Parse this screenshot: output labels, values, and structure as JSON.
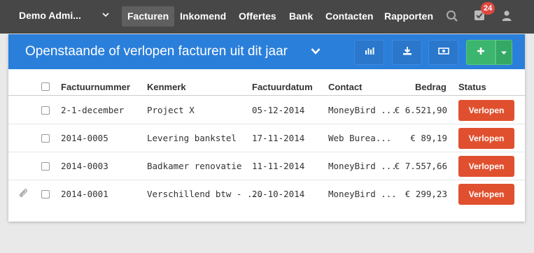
{
  "navbar": {
    "brand": "Demo Admi...",
    "items": [
      "Facturen",
      "Inkomend",
      "Offertes",
      "Bank",
      "Contacten",
      "Rapporten"
    ],
    "active": "Facturen",
    "notification_count": "24"
  },
  "panel": {
    "title": "Openstaande of verlopen facturen uit dit jaar"
  },
  "table": {
    "columns": {
      "factuurnummer": "Factuurnummer",
      "kenmerk": "Kenmerk",
      "factuurdatum": "Factuurdatum",
      "contact": "Contact",
      "bedrag": "Bedrag",
      "status": "Status"
    },
    "rows": [
      {
        "nummer": "2-1-december",
        "kenmerk": "Project X",
        "datum": "05-12-2014",
        "contact": "MoneyBird ...",
        "bedrag": "€ 6.521,90",
        "status": "Verlopen",
        "attachment": false
      },
      {
        "nummer": "2014-0005",
        "kenmerk": "Levering bankstel",
        "datum": "17-11-2014",
        "contact": "Web Burea...",
        "bedrag": "€ 89,19",
        "status": "Verlopen",
        "attachment": false
      },
      {
        "nummer": "2014-0003",
        "kenmerk": "Badkamer renovatie",
        "datum": "11-11-2014",
        "contact": "MoneyBird ...",
        "bedrag": "€ 7.557,66",
        "status": "Verlopen",
        "attachment": false
      },
      {
        "nummer": "2014-0001",
        "kenmerk": "Verschillend btw - ...",
        "datum": "20-10-2014",
        "contact": "MoneyBird ...",
        "bedrag": "€ 299,23",
        "status": "Verlopen",
        "attachment": true
      }
    ]
  },
  "colors": {
    "navbar": "#474747",
    "header_blue": "#2a7fda",
    "status_red": "#e0502f",
    "add_green": "#3cb56f",
    "badge_red": "#e0473f"
  },
  "icons": [
    "search-icon",
    "checkbox-icon",
    "user-icon",
    "chart-icon",
    "download-icon",
    "money-icon",
    "plus-icon",
    "caret-down-icon",
    "paperclip-icon"
  ]
}
